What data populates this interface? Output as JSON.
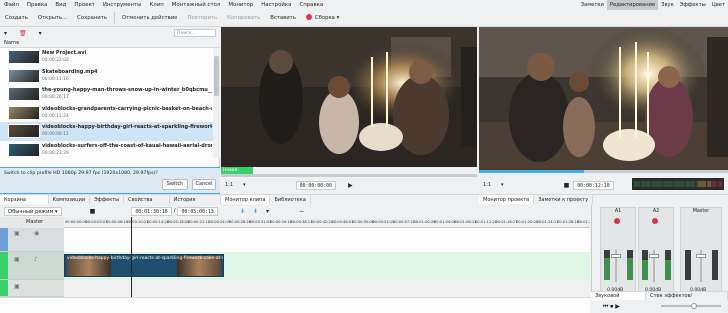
{
  "menubar": {
    "items": [
      "Файл",
      "Правка",
      "Вид",
      "Проект",
      "Инструменты",
      "Клип",
      "Монтажный стол",
      "Монитор",
      "Настройка",
      "Справка"
    ],
    "layouts": [
      "Заметки",
      "Редактирование",
      "Звук",
      "Эффекты",
      "Цвет"
    ],
    "active_layout": "Редактирование"
  },
  "toolbar": {
    "new_label": "Создать",
    "open_label": "Открыть...",
    "save_label": "Сохранить",
    "undo_label": "Отменить действие",
    "redo_label": "Повторить",
    "cut_label": "Копировать",
    "paste_label": "Вставить",
    "render_label": "Сборка"
  },
  "bin": {
    "search_placeholder": "Поиск...",
    "column_name": "Name",
    "clips": [
      {
        "name": "New Project.avi",
        "duration": "00:00:22:02",
        "selected": false,
        "tone": "#49637a"
      },
      {
        "name": "Skateboarding.mp4",
        "duration": "00:00:11:16",
        "selected": false,
        "tone": "#7a8f9c"
      },
      {
        "name": "the-young-happy-man-throws-snow-up-in-winter_b0qbcmu__D.mov",
        "duration": "00:00:26:17",
        "selected": false,
        "tone": "#5a6d74"
      },
      {
        "name": "videoblocks-grandparents-carrying-picnic-basket-on-beach-as-grandchildren-r",
        "duration": "00:00:11:24",
        "selected": false,
        "tone": "#9a8a62"
      },
      {
        "name": "videoblocks-happy-birthday-girl-reacts-at-sparkling-firework-cake-at-surprise",
        "duration": "00:00:08:11",
        "selected": true,
        "tone": "#5b4a3a"
      },
      {
        "name": "videoblocks-surfers-off-the-coast-of-kauai-hawaii-aerial-drone-4k_rdlc",
        "duration": "00:00:23:29",
        "selected": false,
        "tone": "#2f5e78"
      }
    ],
    "dialog_message": "Switch to clip profile HD 1080p 29.97 fps (1920x1080, 29.97fps)?",
    "dialog_switch": "Switch",
    "dialog_cancel": "Cancel"
  },
  "clip_monitor": {
    "zoom": "1:1",
    "timecode": "00:00:00:00",
    "marker_label": "Новая вставка",
    "tabs": [
      "Монитор клипа",
      "Библиотека"
    ]
  },
  "project_monitor": {
    "zoom": "1:1",
    "timecode": "00:00:12:10",
    "tabs": [
      "Монитор проекта",
      "Заметки к проекту"
    ]
  },
  "vu_meter": {
    "ticks": [
      "-45",
      "-40",
      "-35",
      "-30",
      "-25",
      "-20",
      "-15",
      "-10",
      "-5",
      "0"
    ]
  },
  "project_tabs": [
    "Корзина проекта",
    "Композиции",
    "Эффекты",
    "Свойства клипа",
    "История действий"
  ],
  "timeline": {
    "edit_mode": "Обычный режим",
    "current_time": "00:01:30:16",
    "total_time": "00:05:00:13",
    "track_label": "Master",
    "ruler_ticks": [
      "00:00:00:00",
      "00:00:03:07",
      "00:00:06:14",
      "00:00:10:21",
      "00:00:14:28",
      "00:00:18:05",
      "00:00:21:12",
      "00:00:24:19",
      "00:00:28:26",
      "00:00:31:03",
      "00:00:34:10",
      "00:00:38:17",
      "00:00:42:24",
      "00:00:46:01",
      "00:00:50:08",
      "00:00:53:15",
      "00:00:57:22",
      "00:01:00:29",
      "00:01:04:06",
      "00:01:08:13",
      "00:01:12:20",
      "00:01:16:27",
      "00:01:20:04",
      "00:01:24:11",
      "00:01:28:18",
      "00:01:32:25"
    ],
    "clip_name": "videoblocks-happy-birthday-girl-reacts-at-sparkling-firework-cake-at-surprise"
  },
  "mixer": {
    "channels": [
      {
        "name": "A1",
        "db": "0.00dB",
        "level": 0.72
      },
      {
        "name": "A2",
        "db": "0.00dB",
        "level": 0.68
      },
      {
        "name": "Master",
        "db": "0.00dB",
        "level": 0.0
      }
    ],
    "tabs": [
      "Звуковой микшер",
      "Стек эффектов/композиций"
    ]
  },
  "colors": {
    "accent": "#3daee9",
    "record": "#d8334a",
    "clip": "#1f4e6e",
    "audio_track": "#3ccf6e"
  }
}
